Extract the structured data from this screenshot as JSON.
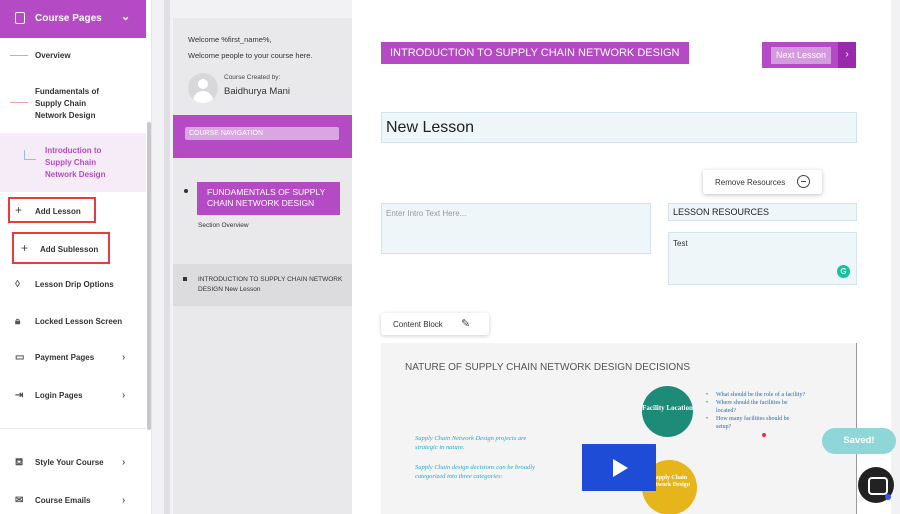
{
  "sidebar": {
    "header_label": "Course Pages",
    "sub_items": [
      {
        "label": "Overview"
      },
      {
        "label": "Fundamentals of Supply Chain Network Design"
      },
      {
        "label": "Introduction to Supply Chain Network Design"
      }
    ],
    "add_lesson": "Add Lesson",
    "add_sublesson": "Add Sublesson",
    "menu": [
      {
        "label": "Lesson Drip Options",
        "icon": "drop-icon"
      },
      {
        "label": "Locked Lesson Screen",
        "icon": "lock-icon"
      },
      {
        "label": "Payment Pages",
        "icon": "tag-icon"
      },
      {
        "label": "Login Pages",
        "icon": "login-icon"
      },
      {
        "label": "Style Your Course",
        "icon": "paint-icon"
      },
      {
        "label": "Course Emails",
        "icon": "mail-icon"
      }
    ]
  },
  "nav": {
    "welcome_line1": "Welcome %first_name%,",
    "welcome_line2": "Welcome people to your course here.",
    "created_by": "Course Created by:",
    "author": "Baidhurya Mani",
    "course_navigation": "COURSE NAVIGATION",
    "lesson_title": "FUNDAMENTALS OF SUPPLY CHAIN NETWORK DESIGN",
    "section_overview": "Section Overview",
    "sublesson": "INTRODUCTION TO SUPPLY CHAIN NETWORK DESIGN New Lesson"
  },
  "editor": {
    "title_badge": "INTRODUCTION TO SUPPLY CHAIN NETWORK DESIGN",
    "next_lesson": "Next Lesson",
    "next_arrow": "›",
    "lesson_name": "New Lesson",
    "remove_resources": "Remove Resources",
    "intro_placeholder": "Enter Intro Text Here...",
    "lesson_resources": "LESSON RESOURCES",
    "resources_text": "Test",
    "content_block": "Content Block",
    "accent": "#b44bc4"
  },
  "slide": {
    "title": "NATURE OF SUPPLY CHAIN NETWORK DESIGN DECISIONS",
    "circle1": "Facility Location",
    "circle2": "Supply Chain Network Design",
    "bullets": [
      "What should be the role of a facility?",
      "Where should the facilities be located?",
      "How many facilities should be setup?"
    ],
    "text1": "Supply Chain Network Design projects are strategic in nature.",
    "text2": "Supply Chain design decisions can be broadly categorized into three categories:"
  },
  "status": {
    "saved": "Saved!"
  }
}
